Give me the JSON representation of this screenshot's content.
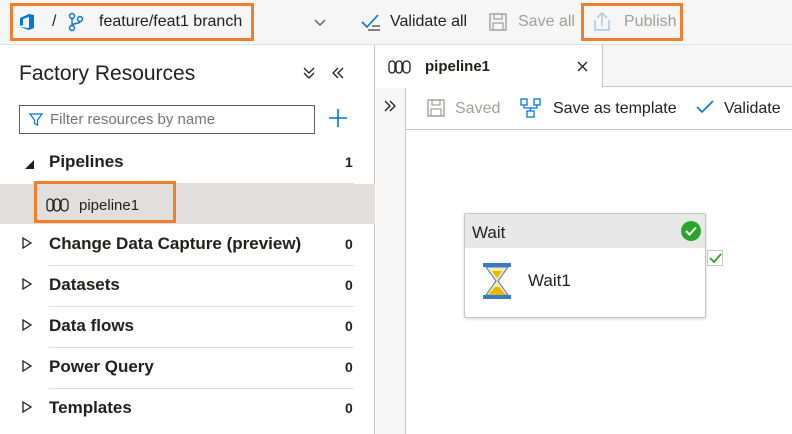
{
  "topbar": {
    "separator": "/",
    "branch": "feature/feat1 branch",
    "validate_all": "Validate all",
    "save_all": "Save all",
    "publish": "Publish"
  },
  "factory": {
    "title": "Factory Resources",
    "filter_placeholder": "Filter resources by name",
    "tree": [
      {
        "label": "Pipelines",
        "count": "1",
        "expanded": true,
        "children": [
          "pipeline1"
        ]
      },
      {
        "label": "Change Data Capture (preview)",
        "count": "0"
      },
      {
        "label": "Datasets",
        "count": "0"
      },
      {
        "label": "Data flows",
        "count": "0"
      },
      {
        "label": "Power Query",
        "count": "0"
      },
      {
        "label": "Templates",
        "count": "0"
      }
    ]
  },
  "editor": {
    "tab_label": "pipeline1",
    "saved": "Saved",
    "save_as_template": "Save as template",
    "validate": "Validate"
  },
  "activity": {
    "type": "Wait",
    "name": "Wait1"
  },
  "colors": {
    "accent_blue": "#0078d4",
    "highlight_orange": "#f07f2c",
    "success_green": "#2aa52b",
    "disabled_gray": "#a19f9d"
  }
}
